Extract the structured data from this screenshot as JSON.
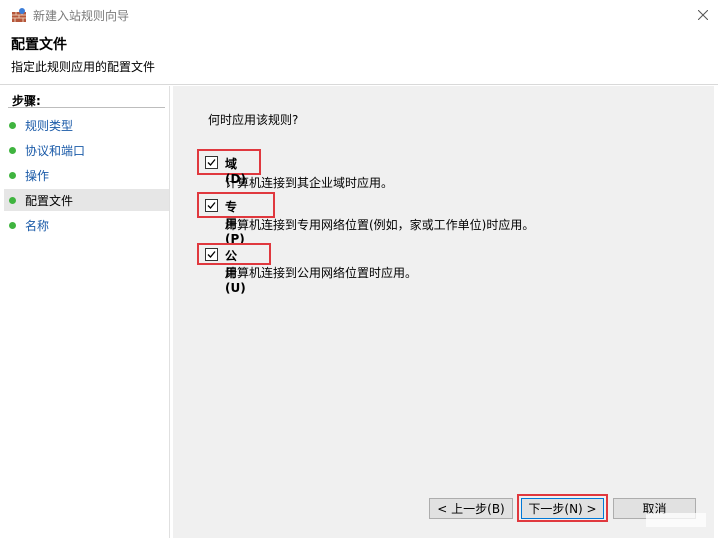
{
  "window": {
    "title": "新建入站规则向导"
  },
  "header": {
    "title": "配置文件",
    "subtitle": "指定此规则应用的配置文件"
  },
  "sidebar": {
    "label": "步骤:",
    "items": [
      {
        "label": "规则类型",
        "active": false
      },
      {
        "label": "协议和端口",
        "active": false
      },
      {
        "label": "操作",
        "active": false
      },
      {
        "label": "配置文件",
        "active": true
      },
      {
        "label": "名称",
        "active": false
      }
    ]
  },
  "main": {
    "question": "何时应用该规则?",
    "options": [
      {
        "label": "域(D)",
        "checked": true,
        "description": "计算机连接到其企业域时应用。"
      },
      {
        "label": "专用(P)",
        "checked": true,
        "description": "计算机连接到专用网络位置(例如，家或工作单位)时应用。"
      },
      {
        "label": "公用(U)",
        "checked": true,
        "description": "计算机连接到公用网络位置时应用。"
      }
    ]
  },
  "buttons": {
    "back": "< 上一步(B)",
    "next": "下一步(N) >",
    "cancel": "取消"
  },
  "colors": {
    "highlight": "#e0383e",
    "step_dot": "#3fb43f",
    "link": "#1a5aa8"
  },
  "icons": {
    "app": "firewall-wall-icon",
    "close": "close-icon",
    "checkbox": "checkmark-icon"
  }
}
